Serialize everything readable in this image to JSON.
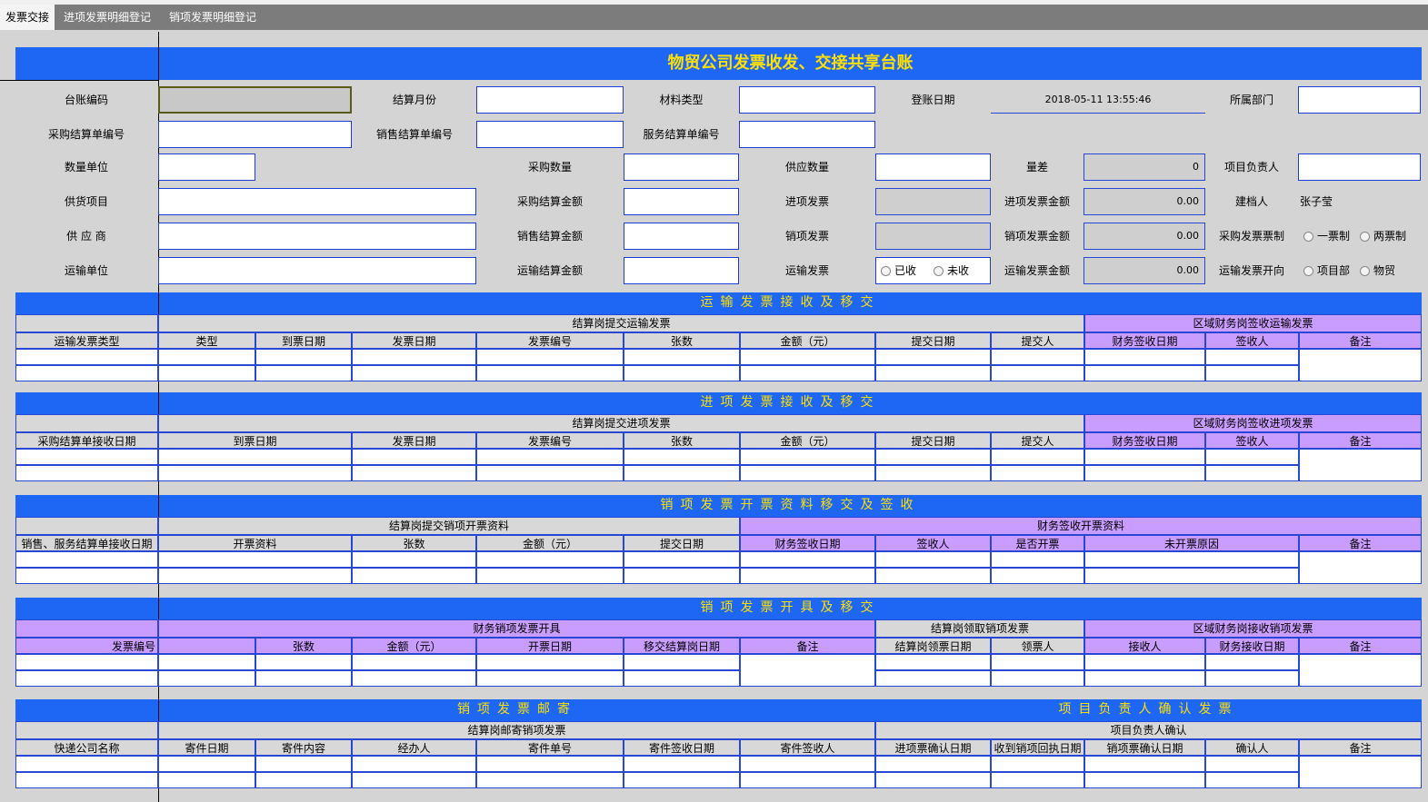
{
  "tabs": [
    "发票交接",
    "进项发票明细登记",
    "销项发票明细登记"
  ],
  "title": "物贸公司发票收发、交接共享台账",
  "form": {
    "ledger_no": "台账编码",
    "settle_month": "结算月份",
    "material_type": "材料类型",
    "register_date": "登账日期",
    "register_date_value": "2018-05-11 13:55:46",
    "department": "所属部门",
    "purchase_settle_no": "采购结算单编号",
    "sales_settle_no": "销售结算单编号",
    "service_settle_no": "服务结算单编号",
    "qty_unit": "数量单位",
    "purchase_qty": "采购数量",
    "supply_qty": "供应数量",
    "qty_diff": "量差",
    "qty_diff_value": "0",
    "project_manager": "项目负责人",
    "supply_project": "供货项目",
    "purchase_amount": "采购结算金额",
    "input_invoice": "进项发票",
    "input_invoice_amount": "进项发票金额",
    "input_invoice_amount_value": "0.00",
    "archivist": "建档人",
    "archivist_value": "张子莹",
    "supplier": "供 应 商",
    "sales_amount": "销售结算金额",
    "output_invoice": "销项发票",
    "output_invoice_amount": "销项发票金额",
    "output_invoice_amount_value": "0.00",
    "purchase_invoice_system": "采购发票票制",
    "one_ticket": "一票制",
    "two_ticket": "两票制",
    "transport_unit": "运输单位",
    "transport_amount": "运输结算金额",
    "transport_invoice": "运输发票",
    "received": "已收",
    "not_received": "未收",
    "transport_invoice_amount": "运输发票金额",
    "transport_invoice_amount_value": "0.00",
    "transport_invoice_direction": "运输发票开向",
    "project_dept": "项目部",
    "wumao": "物贸"
  },
  "s1": {
    "title": "运输发票接收及移交",
    "group_a": "结算岗提交运输发票",
    "group_b": "区域财务岗签收运输发票",
    "cols": [
      "运输发票类型",
      "类型",
      "到票日期",
      "发票日期",
      "发票编号",
      "张数",
      "金额（元）",
      "提交日期",
      "提交人",
      "财务签收日期",
      "签收人",
      "备注"
    ]
  },
  "s2": {
    "title": "进项发票接收及移交",
    "group_a": "结算岗提交进项发票",
    "group_b": "区域财务岗签收进项发票",
    "cols": [
      "采购结算单接收日期",
      "到票日期",
      "发票日期",
      "发票编号",
      "张数",
      "金额（元）",
      "提交日期",
      "提交人",
      "财务签收日期",
      "签收人",
      "备注"
    ]
  },
  "s3": {
    "title": "销项发票开票资料移交及签收",
    "group_a": "结算岗提交销项开票资料",
    "group_b": "财务签收开票资料",
    "cols": [
      "销售、服务结算单接收日期",
      "开票资料",
      "张数",
      "金额（元）",
      "提交日期",
      "财务签收日期",
      "签收人",
      "是否开票",
      "未开票原因",
      "备注"
    ]
  },
  "s4": {
    "title": "销项发票开具及移交",
    "group_a": "财务销项发票开具",
    "group_b": "结算岗领取销项发票",
    "group_c": "区域财务岗接收销项发票",
    "cols": [
      "发票编号",
      "张数",
      "金额（元）",
      "开票日期",
      "移交结算岗日期",
      "备注",
      "结算岗领票日期",
      "领票人",
      "接收人",
      "财务接收日期",
      "备注"
    ]
  },
  "s5": {
    "title_left": "销项发票邮寄",
    "title_right": "项目负责人确认发票",
    "group_a": "结算岗邮寄销项发票",
    "group_b": "项目负责人确认",
    "cols": [
      "快递公司名称",
      "寄件日期",
      "寄件内容",
      "经办人",
      "寄件单号",
      "寄件签收日期",
      "寄件签收人",
      "进项票确认日期",
      "收到销项回执日期",
      "销项票确认日期",
      "确认人",
      "备注"
    ]
  },
  "colors": {
    "banner": "#1e67f5",
    "banner_text": "#ffe000",
    "purple_header": "#c99cff",
    "grid_line": "#2747d4"
  }
}
